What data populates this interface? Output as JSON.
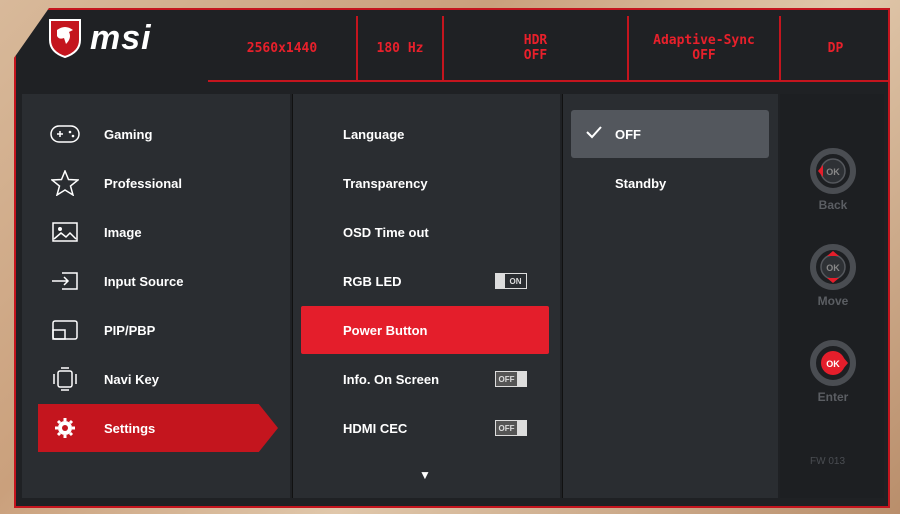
{
  "brand": {
    "name": "msi"
  },
  "status": [
    {
      "label": "2560x1440",
      "sub": ""
    },
    {
      "label": "180 Hz",
      "sub": ""
    },
    {
      "label": "HDR",
      "sub": "OFF"
    },
    {
      "label": "Adaptive-Sync",
      "sub": "OFF"
    },
    {
      "label": "DP",
      "sub": ""
    }
  ],
  "nav": [
    {
      "label": "Gaming",
      "icon": "gamepad-icon"
    },
    {
      "label": "Professional",
      "icon": "star-icon"
    },
    {
      "label": "Image",
      "icon": "image-icon"
    },
    {
      "label": "Input Source",
      "icon": "input-source-icon"
    },
    {
      "label": "PIP/PBP",
      "icon": "pip-icon"
    },
    {
      "label": "Navi Key",
      "icon": "navi-key-icon"
    },
    {
      "label": "Settings",
      "icon": "gear-icon",
      "active": true
    }
  ],
  "settings": [
    {
      "label": "Language"
    },
    {
      "label": "Transparency"
    },
    {
      "label": "OSD Time out"
    },
    {
      "label": "RGB LED",
      "toggle": "ON"
    },
    {
      "label": "Power Button",
      "active": true
    },
    {
      "label": "Info. On Screen",
      "toggle": "OFF"
    },
    {
      "label": "HDMI CEC",
      "toggle": "OFF"
    }
  ],
  "options": [
    {
      "label": "OFF",
      "selected": true
    },
    {
      "label": "Standby"
    }
  ],
  "keys": [
    {
      "label": "Back",
      "icon": "navi-back-icon"
    },
    {
      "label": "Move",
      "icon": "navi-move-icon"
    },
    {
      "label": "Enter",
      "icon": "navi-enter-icon"
    }
  ],
  "key_ok": "OK",
  "firmware": "FW 013",
  "colors": {
    "accent": "#c4151e",
    "highlight": "#e41e2b",
    "panel": "#2a2d31"
  }
}
